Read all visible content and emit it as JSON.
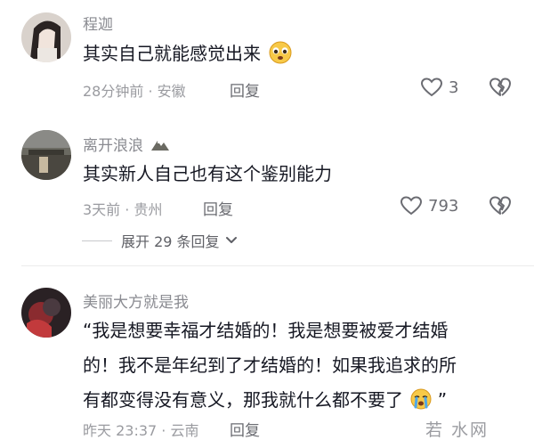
{
  "comments": [
    {
      "username": "程迦",
      "text": "其实自己就能感觉出来",
      "time_location": "28分钟前 · 安徽",
      "reply_label": "回复",
      "like_count": "3",
      "emoji": "crying-face-emoji"
    },
    {
      "username": "离开浪浪",
      "username_icon": "mountain-icon",
      "text": "其实新人自己也有这个鉴别能力",
      "time_location": "3天前 · 贵州",
      "reply_label": "回复",
      "like_count": "793",
      "expand_label": "展开 29 条回复"
    },
    {
      "username": "美丽大方就是我",
      "text_line1": "“我是想要幸福才结婚的！我是想要被爱才结婚",
      "text_line2": "的！我不是年纪到了才结婚的！如果我追求的所",
      "text_line3": "有都变得没有意义，那我就什么都不要了",
      "text_end": "”",
      "time_location": "昨天 23:37 · 云南",
      "reply_label": "回复",
      "emoji": "crying-emoji"
    }
  ],
  "watermark": "若 水网",
  "colors": {
    "text": "#161823",
    "meta": "#9a9ba0",
    "username": "#8a8b91",
    "emoji_yellow": "#f7c948"
  }
}
